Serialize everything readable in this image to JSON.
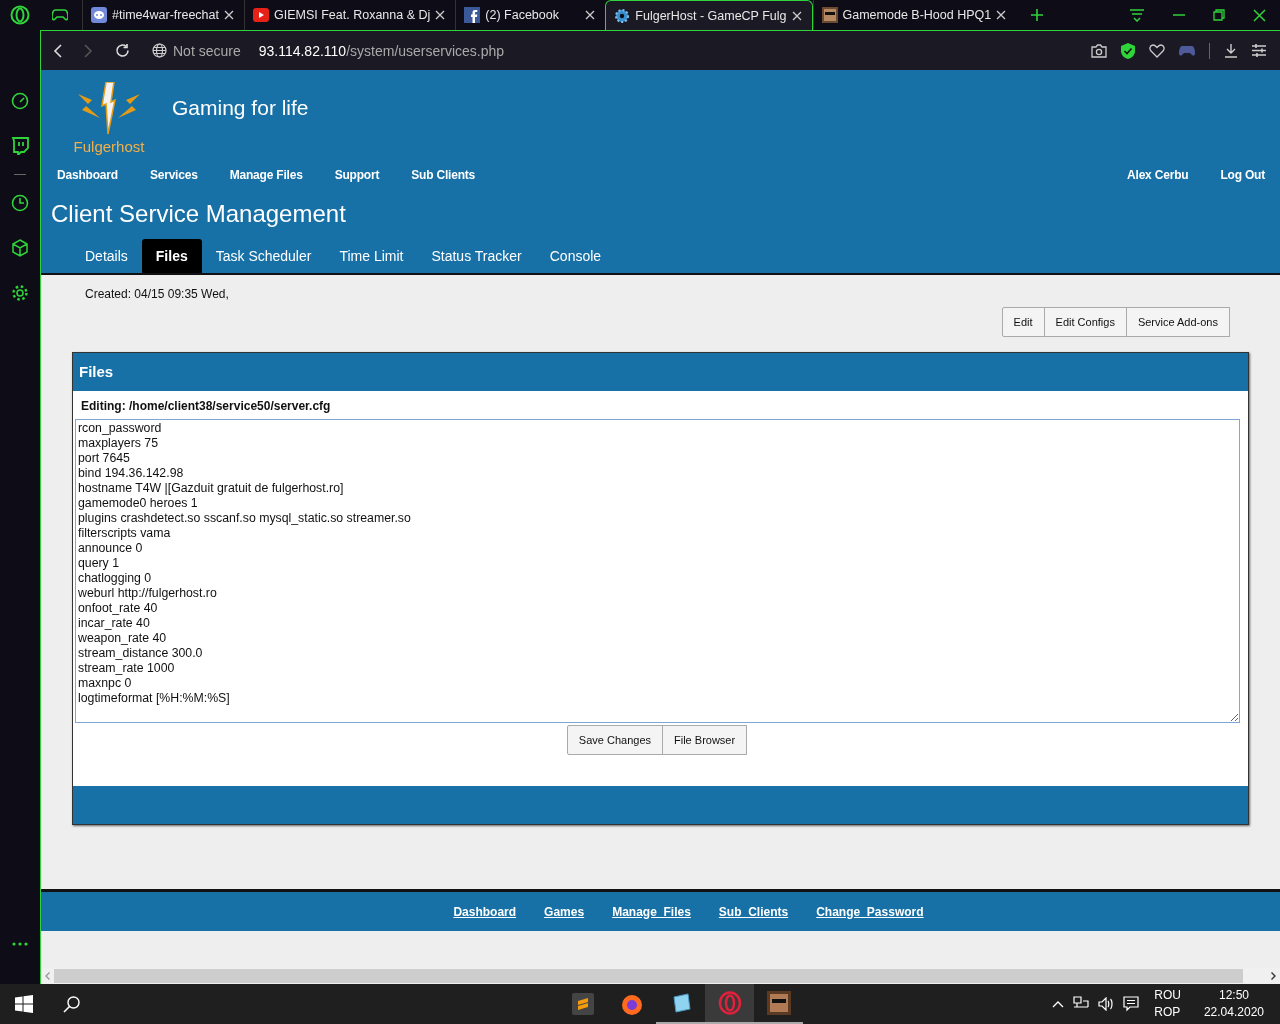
{
  "browser": {
    "tabs": [
      {
        "title": "#time4war-freechat",
        "selected": false
      },
      {
        "title": "GIEMSI Feat. Roxanna & Dj",
        "selected": false
      },
      {
        "title": "(2) Facebook",
        "selected": false
      },
      {
        "title": "FulgerHost - GameCP Fulg",
        "selected": true
      },
      {
        "title": "Gamemode B-Hood HPQ1",
        "selected": false
      }
    ],
    "security": "Not secure",
    "url": "93.114.82.110/system/userservices.php"
  },
  "header": {
    "logo_text": "Fulgerhost",
    "tagline": "Gaming for life",
    "nav": [
      "Dashboard",
      "Services",
      "Manage Files",
      "Support",
      "Sub Clients"
    ],
    "user_nav": [
      "Alex Cerbu",
      "Log Out"
    ],
    "title": "Client Service Management",
    "tabs": [
      {
        "label": "Details",
        "selected": false
      },
      {
        "label": "Files",
        "selected": true
      },
      {
        "label": "Task Scheduler",
        "selected": false
      },
      {
        "label": "Time Limit",
        "selected": false
      },
      {
        "label": "Status Tracker",
        "selected": false
      },
      {
        "label": "Console",
        "selected": false
      }
    ]
  },
  "created": "Created: 04/15 09:35 Wed,",
  "actions": [
    "Edit",
    "Edit Configs",
    "Service Add-ons"
  ],
  "panel": {
    "title": "Files",
    "editing": "Editing: /home/client38/service50/server.cfg",
    "lines": [
      "rcon_password ",
      "maxplayers 75",
      "port 7645",
      "bind 194.36.142.98",
      "hostname T4W |[Gazduit gratuit de fulgerhost.ro]",
      "gamemode0 heroes 1",
      "plugins crashdetect.so sscanf.so mysql_static.so streamer.so",
      "filterscripts vama",
      "announce 0",
      "query 1",
      "chatlogging 0",
      "weburl http://fulgerhost.ro",
      "onfoot_rate 40",
      "incar_rate 40",
      "weapon_rate 40",
      "stream_distance 300.0",
      "stream_rate 1000",
      "maxnpc 0",
      "logtimeformat [%H:%M:%S]"
    ],
    "buttons": [
      "Save Changes",
      "File Browser"
    ]
  },
  "footer_links": [
    "Dashboard",
    "Games",
    "Manage  Files",
    "Sub  Clients",
    "Change  Password"
  ],
  "taskbar": {
    "language": [
      "ROU",
      "ROP"
    ],
    "time": "12:50",
    "date": "22.04.2020"
  }
}
